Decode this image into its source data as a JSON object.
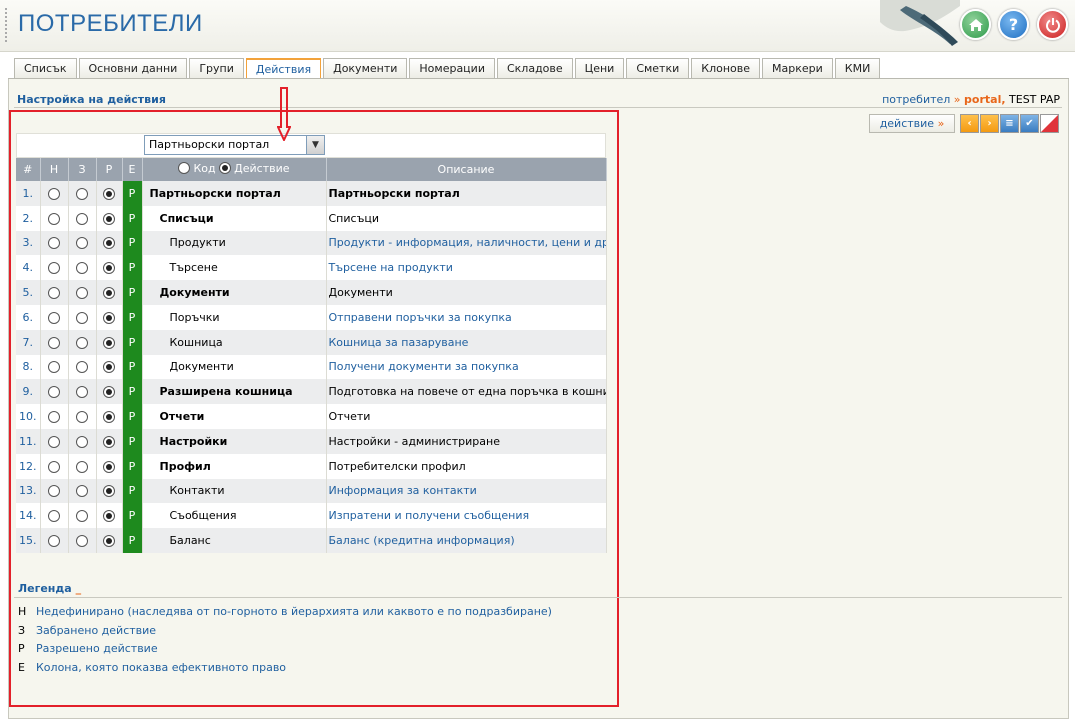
{
  "app": {
    "title": "ПОТРЕБИТЕЛИ"
  },
  "header_buttons": [
    {
      "icon": "home-icon"
    },
    {
      "icon": "help-icon",
      "label": "?"
    },
    {
      "icon": "power-icon"
    }
  ],
  "tabs": [
    {
      "label": "Списък",
      "active": false
    },
    {
      "label": "Основни данни",
      "active": false
    },
    {
      "label": "Групи",
      "active": false
    },
    {
      "label": "Действия",
      "active": true
    },
    {
      "label": "Документи",
      "active": false
    },
    {
      "label": "Номерации",
      "active": false
    },
    {
      "label": "Складове",
      "active": false
    },
    {
      "label": "Цени",
      "active": false
    },
    {
      "label": "Сметки",
      "active": false
    },
    {
      "label": "Клонове",
      "active": false
    },
    {
      "label": "Маркери",
      "active": false
    },
    {
      "label": "КМИ",
      "active": false
    }
  ],
  "section": {
    "title": "Настройка на действия"
  },
  "breadcrumb": {
    "prefix": "потребител",
    "sep": "»",
    "highlight": "portal,",
    "user": "TEST PAP"
  },
  "toolbar": {
    "action_label": "действие",
    "action_arrow": "»"
  },
  "filter": {
    "selected": "Партньорски портал"
  },
  "table": {
    "headers": {
      "num": "#",
      "h": "Н",
      "z": "З",
      "r": "Р",
      "e": "Е",
      "code": "Код",
      "action": "Действие",
      "desc": "Описание"
    },
    "sort_by": "Действие",
    "rows": [
      {
        "num": "1.",
        "selected": "r",
        "eff": "Р",
        "name": "Партньорски портал",
        "level": 1,
        "desc": "Партньорски портал",
        "desc_style": "bold"
      },
      {
        "num": "2.",
        "selected": "r",
        "eff": "Р",
        "name": "Списъци",
        "level": 2,
        "desc": "Списъци",
        "desc_style": "plain"
      },
      {
        "num": "3.",
        "selected": "r",
        "eff": "Р",
        "name": "Продукти",
        "level": 3,
        "desc": "Продукти - информация, наличности, цени и др.",
        "desc_style": "link"
      },
      {
        "num": "4.",
        "selected": "r",
        "eff": "Р",
        "name": "Търсене",
        "level": 3,
        "desc": "Търсене на продукти",
        "desc_style": "link"
      },
      {
        "num": "5.",
        "selected": "r",
        "eff": "Р",
        "name": "Документи",
        "level": 2,
        "desc": "Документи",
        "desc_style": "plain"
      },
      {
        "num": "6.",
        "selected": "r",
        "eff": "Р",
        "name": "Поръчки",
        "level": 3,
        "desc": "Отправени поръчки за покупка",
        "desc_style": "link"
      },
      {
        "num": "7.",
        "selected": "r",
        "eff": "Р",
        "name": "Кошница",
        "level": 3,
        "desc": "Кошница за пазаруване",
        "desc_style": "link"
      },
      {
        "num": "8.",
        "selected": "r",
        "eff": "Р",
        "name": "Документи",
        "level": 3,
        "desc": "Получени документи за покупка",
        "desc_style": "link"
      },
      {
        "num": "9.",
        "selected": "r",
        "eff": "Р",
        "name": "Разширена кошница",
        "level": 2,
        "desc": "Подготовка на повече от една поръчка в кошницата",
        "desc_style": "plain"
      },
      {
        "num": "10.",
        "selected": "r",
        "eff": "Р",
        "name": "Отчети",
        "level": 2,
        "desc": "Отчети",
        "desc_style": "plain"
      },
      {
        "num": "11.",
        "selected": "r",
        "eff": "Р",
        "name": "Настройки",
        "level": 2,
        "desc": "Настройки - администриране",
        "desc_style": "plain"
      },
      {
        "num": "12.",
        "selected": "r",
        "eff": "Р",
        "name": "Профил",
        "level": 2,
        "desc": "Потребителски профил",
        "desc_style": "plain"
      },
      {
        "num": "13.",
        "selected": "r",
        "eff": "Р",
        "name": "Контакти",
        "level": 3,
        "desc": "Информация за контакти",
        "desc_style": "link"
      },
      {
        "num": "14.",
        "selected": "r",
        "eff": "Р",
        "name": "Съобщения",
        "level": 3,
        "desc": "Изпратени и получени съобщения",
        "desc_style": "link"
      },
      {
        "num": "15.",
        "selected": "r",
        "eff": "Р",
        "name": "Баланс",
        "level": 3,
        "desc": "Баланс (кредитна информация)",
        "desc_style": "link"
      }
    ]
  },
  "legend": {
    "title": "Легенда",
    "marker": "_",
    "items": [
      {
        "key": "Н",
        "text": "Недефинирано (наследява от по-горното в йерархията или каквото е по подразбиране)"
      },
      {
        "key": "З",
        "text": "Забранено действие"
      },
      {
        "key": "Р",
        "text": "Разрешено действие"
      },
      {
        "key": "Е",
        "text": "Колона, която показва ефективното право"
      }
    ]
  },
  "colors": {
    "accent": "#1f5f9f",
    "highlight": "#e8661a",
    "effective": "#1e8a1e",
    "annotation": "#e3202a"
  }
}
